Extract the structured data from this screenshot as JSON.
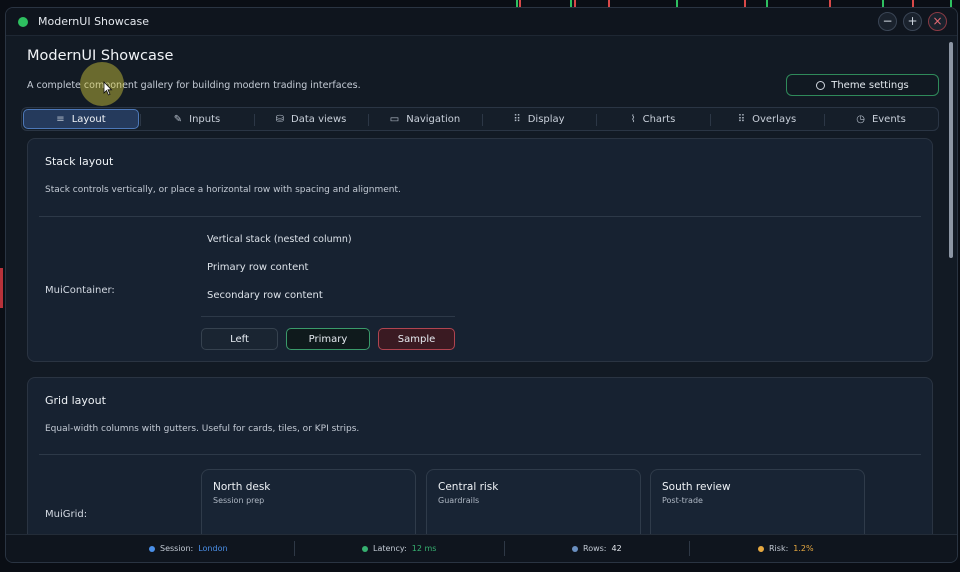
{
  "window": {
    "title": "ModernUI Showcase",
    "controls": {
      "minimize": "−",
      "maximize": "+",
      "close": "×"
    }
  },
  "header": {
    "title": "ModernUI Showcase",
    "subtitle": "A complete component gallery for building modern trading interfaces.",
    "theme_button": "Theme settings"
  },
  "tabs": [
    {
      "label": "Layout",
      "icon": "list-icon",
      "glyph": "≡",
      "active": true
    },
    {
      "label": "Inputs",
      "icon": "edit-icon",
      "glyph": "✎"
    },
    {
      "label": "Data views",
      "icon": "database-icon",
      "glyph": "⛁"
    },
    {
      "label": "Navigation",
      "icon": "folder-icon",
      "glyph": "▭"
    },
    {
      "label": "Display",
      "icon": "grid-dots-icon",
      "glyph": "⠿"
    },
    {
      "label": "Charts",
      "icon": "chart-line-icon",
      "glyph": "⌇"
    },
    {
      "label": "Overlays",
      "icon": "grid-dots-icon",
      "glyph": "⠿"
    },
    {
      "label": "Events",
      "icon": "clock-icon",
      "glyph": "◷"
    }
  ],
  "stack_card": {
    "title": "Stack layout",
    "description": "Stack controls vertically, or place a horizontal row with spacing and alignment.",
    "row_label": "MuiContainer:",
    "items": [
      "Vertical stack (nested column)",
      "Primary row content",
      "Secondary row content"
    ],
    "buttons": {
      "left": "Left",
      "primary": "Primary",
      "sample": "Sample"
    }
  },
  "grid_card": {
    "title": "Grid layout",
    "description": "Equal-width columns with gutters. Useful for cards, tiles, or KPI strips.",
    "row_label": "MuiGrid:",
    "tiles": [
      {
        "title": "North desk",
        "subtitle": "Session prep"
      },
      {
        "title": "Central risk",
        "subtitle": "Guardrails"
      },
      {
        "title": "South review",
        "subtitle": "Post-trade"
      }
    ]
  },
  "status": {
    "session": {
      "label": "Session:",
      "value": "London",
      "color": "#4a8fe8"
    },
    "latency": {
      "label": "Latency:",
      "value": "12 ms",
      "color": "#36b070"
    },
    "rows": {
      "label": "Rows:",
      "value": "42",
      "color": "#6a8fc0"
    },
    "risk": {
      "label": "Risk:",
      "value": "1.2%",
      "color": "#e6a840"
    }
  },
  "colors": {
    "accent": "#4d78b8",
    "success": "#2ec060",
    "danger": "#b04450"
  }
}
